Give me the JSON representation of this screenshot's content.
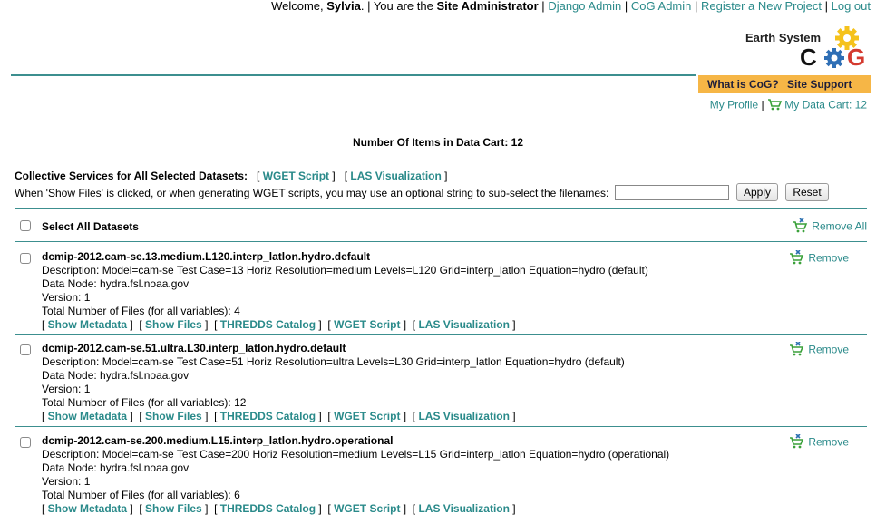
{
  "topnav": {
    "welcome": "Welcome,",
    "user": "Sylvia",
    "role_prefix": ". | You are the",
    "role": "Site Administrator",
    "links": [
      "Django Admin",
      "CoG Admin",
      "Register a New Project",
      "Log out"
    ]
  },
  "logo": {
    "line1": "Earth System",
    "line2": "CoG"
  },
  "support": {
    "what_is": "What is CoG?",
    "site_support": "Site Support"
  },
  "profile": {
    "my_profile": "My Profile",
    "my_cart": "My Data Cart: 12"
  },
  "cart_count": "Number Of Items in Data Cart: 12",
  "collective": {
    "label": "Collective Services for All Selected Datasets:",
    "wget": "WGET Script",
    "las": "LAS Visualization"
  },
  "filter": {
    "text": "When 'Show Files' is clicked, or when generating WGET scripts, you may use an optional string to sub-select the filenames:",
    "value": "",
    "apply": "Apply",
    "reset": "Reset"
  },
  "select_all": "Select All Datasets",
  "remove_all": "Remove All",
  "link_labels": {
    "show_metadata": "Show Metadata",
    "show_files": "Show Files",
    "thredds": "THREDDS Catalog",
    "wget": "WGET Script",
    "las": "LAS Visualization",
    "remove": "Remove"
  },
  "datasets": [
    {
      "title": "dcmip-2012.cam-se.13.medium.L120.interp_latlon.hydro.default",
      "description": "Description: Model=cam-se Test Case=13 Horiz Resolution=medium Levels=L120 Grid=interp_latlon Equation=hydro (default)",
      "data_node": "Data Node: hydra.fsl.noaa.gov",
      "version": "Version: 1",
      "files": "Total Number of Files (for all variables): 4"
    },
    {
      "title": "dcmip-2012.cam-se.51.ultra.L30.interp_latlon.hydro.default",
      "description": "Description: Model=cam-se Test Case=51 Horiz Resolution=ultra Levels=L30 Grid=interp_latlon Equation=hydro (default)",
      "data_node": "Data Node: hydra.fsl.noaa.gov",
      "version": "Version: 1",
      "files": "Total Number of Files (for all variables): 12"
    },
    {
      "title": "dcmip-2012.cam-se.200.medium.L15.interp_latlon.hydro.operational",
      "description": "Description: Model=cam-se Test Case=200 Horiz Resolution=medium Levels=L15 Grid=interp_latlon Equation=hydro (operational)",
      "data_node": "Data Node: hydra.fsl.noaa.gov",
      "version": "Version: 1",
      "files": "Total Number of Files (for all variables): 6"
    }
  ],
  "colors": {
    "link": "#2a8a8a",
    "rule": "#3c8f8f",
    "support_bar": "#f6b646"
  }
}
